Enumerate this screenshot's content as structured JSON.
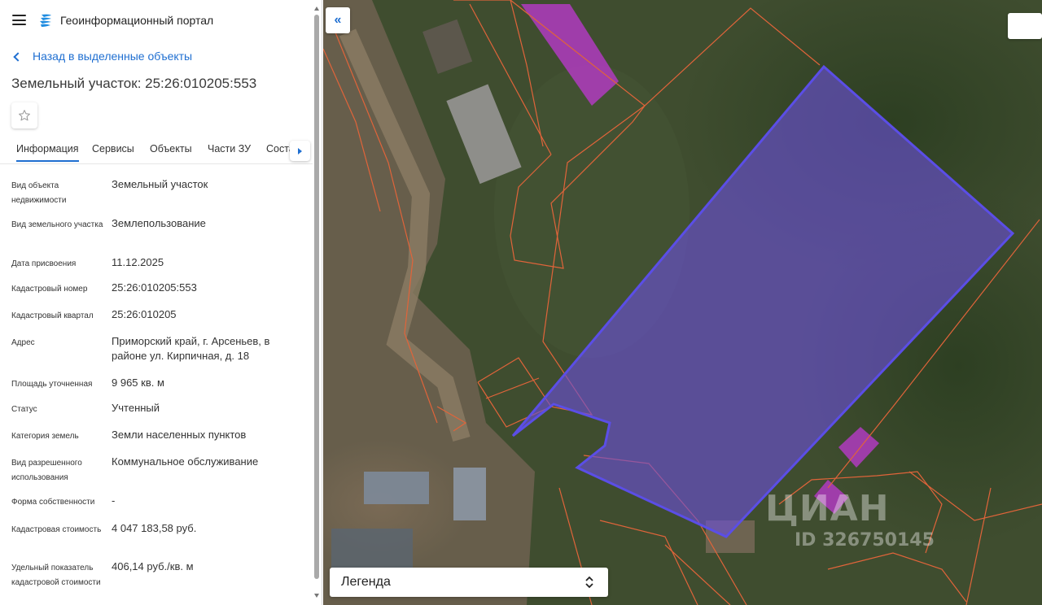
{
  "header": {
    "title": "Геоинформационный портал"
  },
  "nav": {
    "back_label": "Назад в выделенные объекты"
  },
  "object": {
    "title": "Земельный участок: 25:26:010205:553"
  },
  "tabs": [
    {
      "label": "Информация",
      "active": true
    },
    {
      "label": "Сервисы"
    },
    {
      "label": "Объекты"
    },
    {
      "label": "Части ЗУ"
    },
    {
      "label": "Соста"
    }
  ],
  "properties": [
    {
      "label": "Вид объекта недвижимости",
      "value": "Земельный участок"
    },
    {
      "label": "Вид земельного участка",
      "value": "Землепользование"
    },
    {
      "label": "Дата присвоения",
      "value": "11.12.2025"
    },
    {
      "label": "Кадастровый номер",
      "value": "25:26:010205:553"
    },
    {
      "label": "Кадастровый квартал",
      "value": "25:26:010205"
    },
    {
      "label": "Адрес",
      "value": "Приморский край, г. Арсеньев, в районе ул. Кирпичная, д. 18"
    },
    {
      "label": "Площадь уточненная",
      "value": "9 965 кв. м"
    },
    {
      "label": "Статус",
      "value": "Учтенный"
    },
    {
      "label": "Категория земель",
      "value": "Земли населенных пунктов"
    },
    {
      "label": "Вид разрешенного использования",
      "value": "Коммунальное обслуживание"
    },
    {
      "label": "Форма собственности",
      "value": "-"
    },
    {
      "label": "Кадастровая стоимость",
      "value": "4 047 183,58 руб."
    },
    {
      "label": "Удельный показатель кадастровой стоимости",
      "value": "406,14 руб./кв. м"
    }
  ],
  "map": {
    "legend_label": "Легенда",
    "collapse_glyph": "«",
    "watermark": {
      "logo": "ЦИАН",
      "id": "ID 326750145"
    }
  },
  "colors": {
    "accent": "#1f6fd1",
    "parcel_fill": "#6a4fd8",
    "parcel_stroke": "#5b4ee6",
    "boundary": "#e0643a",
    "magenta_parcel": "#c03ccf"
  },
  "icons": {
    "menu": "hamburger-icon",
    "logo": "portal-logo-icon",
    "back": "chevron-left-icon",
    "favorite": "star-outline-icon",
    "tab_scroll": "triangle-right-icon",
    "collapse": "double-chevron-left-icon",
    "legend_toggle": "chevron-up-down-icon"
  }
}
